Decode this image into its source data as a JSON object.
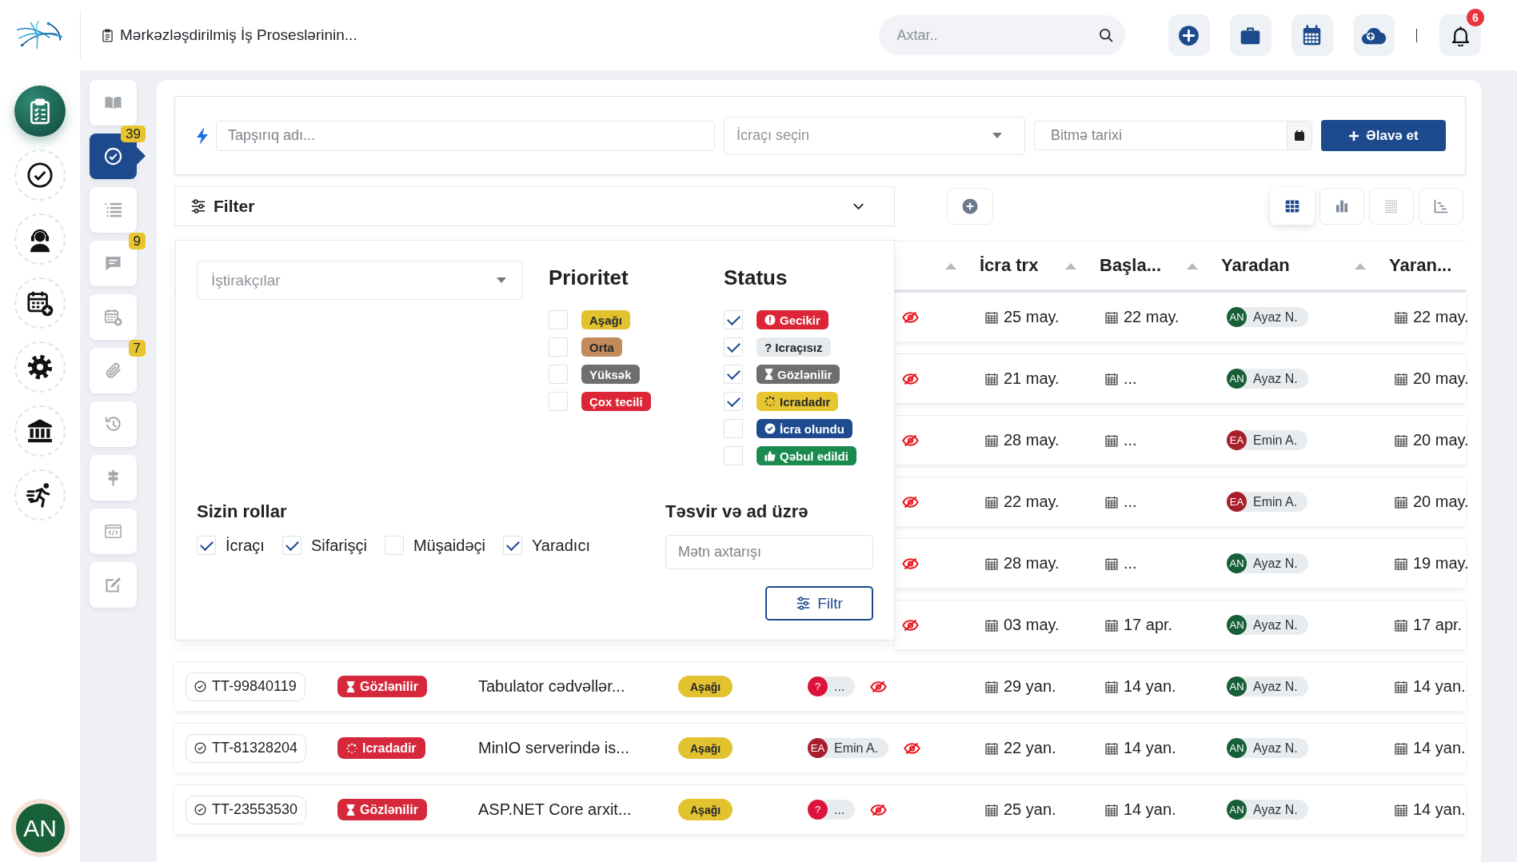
{
  "topbar": {
    "title": "Mərkəzləşdirilmiş İş Proseslərinin...",
    "search": {
      "placeholder": "Axtar.."
    },
    "actions": [
      {
        "kind": "add"
      },
      {
        "kind": "briefcase"
      },
      {
        "kind": "calendar"
      },
      {
        "kind": "cloud"
      }
    ],
    "notifications": {
      "count": "6"
    }
  },
  "main_nav": {
    "items": [
      {
        "kind": "tasks",
        "selected": true
      },
      {
        "kind": "check",
        "selected": false
      },
      {
        "kind": "support",
        "selected": false
      },
      {
        "kind": "calendar",
        "selected": false
      },
      {
        "kind": "settings",
        "selected": false
      },
      {
        "kind": "bank",
        "selected": false
      },
      {
        "kind": "activity",
        "selected": false
      }
    ]
  },
  "user": {
    "initials": "AN"
  },
  "sub_nav": {
    "items": [
      {
        "kind": "book",
        "selected": false
      },
      {
        "kind": "tasks",
        "selected": true,
        "badge": "39"
      },
      {
        "kind": "list",
        "selected": false
      },
      {
        "kind": "chat",
        "selected": false,
        "badge": "9"
      },
      {
        "kind": "calendar",
        "selected": false
      },
      {
        "kind": "attachment",
        "selected": false,
        "badge": "7"
      },
      {
        "kind": "history",
        "selected": false
      },
      {
        "kind": "signpost",
        "selected": false
      },
      {
        "kind": "code",
        "selected": false
      },
      {
        "kind": "edit",
        "selected": false
      }
    ]
  },
  "quick_add": {
    "task_name": {
      "placeholder": "Tapşırıq adı..."
    },
    "executor_select": {
      "placeholder": "İcraçı seçin"
    },
    "due_date": {
      "placeholder": "Bitmə tarixi"
    },
    "add_button": "Əlavə et"
  },
  "filter": {
    "title": "Filter",
    "expanded": true,
    "participants": {
      "placeholder": "İştirakçılar"
    },
    "priority": {
      "title": "Prioritet",
      "options": [
        {
          "label": "Aşağı",
          "color": "#e3c22f",
          "checked": false
        },
        {
          "label": "Orta",
          "color": "#c28b5c",
          "checked": false
        },
        {
          "label": "Yüksək",
          "color": "#6e6e6e",
          "checked": false
        },
        {
          "label": "Çox tecili",
          "color": "#dc2536",
          "checked": false
        }
      ]
    },
    "status": {
      "title": "Status",
      "options": [
        {
          "kind": "overdue",
          "label": "Gecikir",
          "color": "#dc2536",
          "checked": true
        },
        {
          "kind": "unassigned",
          "label": "? Icraçısız",
          "color": "#e6eaed",
          "checked": true
        },
        {
          "kind": "waiting",
          "label": "Gözlənilir",
          "color": "#6e6e6e",
          "checked": true
        },
        {
          "kind": "in_progress",
          "label": "Icradadır",
          "color": "#e6c52f",
          "checked": true
        },
        {
          "kind": "done",
          "label": "İcra olundu",
          "color": "#1e4a8e",
          "checked": false
        },
        {
          "kind": "accepted",
          "label": "Qəbul edildi",
          "color": "#1a8a4f",
          "checked": false
        }
      ]
    },
    "roles": {
      "title": "Sizin rollar",
      "options": [
        {
          "label": "İcraçı",
          "checked": true
        },
        {
          "label": "Sifarişçi",
          "checked": true
        },
        {
          "label": "Müşaidəçi",
          "checked": false
        },
        {
          "label": "Yaradıcı",
          "checked": true
        }
      ]
    },
    "text_search": {
      "title": "Təsvir və ad üzrə",
      "placeholder": "Mətn axtarışı"
    },
    "apply_button": "Filtr"
  },
  "views": [
    {
      "kind": "table",
      "selected": true
    },
    {
      "kind": "chart",
      "selected": false
    },
    {
      "kind": "grid",
      "selected": false
    },
    {
      "kind": "timeline",
      "selected": false
    }
  ],
  "table": {
    "columns": [
      {
        "sortable": true
      },
      {
        "label": "İcra trx",
        "sortable": true
      },
      {
        "label": "Başla...",
        "sortable": true
      },
      {
        "label": "Yaradan",
        "sortable": true
      },
      {
        "label": "Yaran..."
      }
    ],
    "rows": [
      {
        "hidden": true,
        "due": "25 may.",
        "start": "22 may.",
        "creator": {
          "initials": "AN",
          "name": "Ayaz N.",
          "color": "#175f38"
        },
        "created": "22 may."
      },
      {
        "hidden": true,
        "due": "21 may.",
        "start": "...",
        "creator": {
          "initials": "AN",
          "name": "Ayaz N.",
          "color": "#175f38"
        },
        "created": "20 may."
      },
      {
        "hidden": true,
        "due": "28 may.",
        "start": "...",
        "creator": {
          "initials": "EA",
          "name": "Emin A.",
          "color": "#a81e2c"
        },
        "created": "20 may."
      },
      {
        "hidden": true,
        "due": "22 may.",
        "start": "...",
        "creator": {
          "initials": "EA",
          "name": "Emin A.",
          "color": "#a81e2c"
        },
        "created": "20 may."
      },
      {
        "hidden": true,
        "due": "28 may.",
        "start": "...",
        "creator": {
          "initials": "AN",
          "name": "Ayaz N.",
          "color": "#175f38"
        },
        "created": "19 may."
      },
      {
        "hidden": true,
        "due": "03 may.",
        "start": "17 apr.",
        "creator": {
          "initials": "AN",
          "name": "Ayaz N.",
          "color": "#175f38"
        },
        "created": "17 apr."
      },
      {
        "id": "TT-99840119",
        "status": {
          "kind": "waiting",
          "label": "Gözlənilir",
          "color": "#d6283b"
        },
        "title": "Tabulator cədvəllər...",
        "priority": {
          "label": "Aşağı",
          "color": "#e3c22f"
        },
        "executor": {
          "initials": "?",
          "name": "...",
          "color": "#dc143c"
        },
        "hidden": true,
        "due": "29 yan.",
        "start": "14 yan.",
        "creator": {
          "initials": "AN",
          "name": "Ayaz N.",
          "color": "#175f38"
        },
        "created": "14 yan."
      },
      {
        "id": "TT-81328204",
        "status": {
          "kind": "in_progress",
          "label": "Icradadir",
          "color": "#d6283b"
        },
        "title": "MinIO serverində is...",
        "priority": {
          "label": "Aşağı",
          "color": "#e3c22f"
        },
        "executor": {
          "initials": "EA",
          "name": "Emin A.",
          "color": "#a81e2c"
        },
        "hidden": true,
        "due": "22 yan.",
        "start": "14 yan.",
        "creator": {
          "initials": "AN",
          "name": "Ayaz N.",
          "color": "#175f38"
        },
        "created": "14 yan."
      },
      {
        "id": "TT-23553530",
        "status": {
          "kind": "waiting",
          "label": "Gözlənilir",
          "color": "#d6283b"
        },
        "title": "ASP.NET Core arxit...",
        "priority": {
          "label": "Aşağı",
          "color": "#e3c22f"
        },
        "executor": {
          "initials": "?",
          "name": "...",
          "color": "#dc143c"
        },
        "hidden": true,
        "due": "25 yan.",
        "start": "14 yan.",
        "creator": {
          "initials": "AN",
          "name": "Ayaz N.",
          "color": "#175f38"
        },
        "created": "14 yan."
      }
    ]
  }
}
